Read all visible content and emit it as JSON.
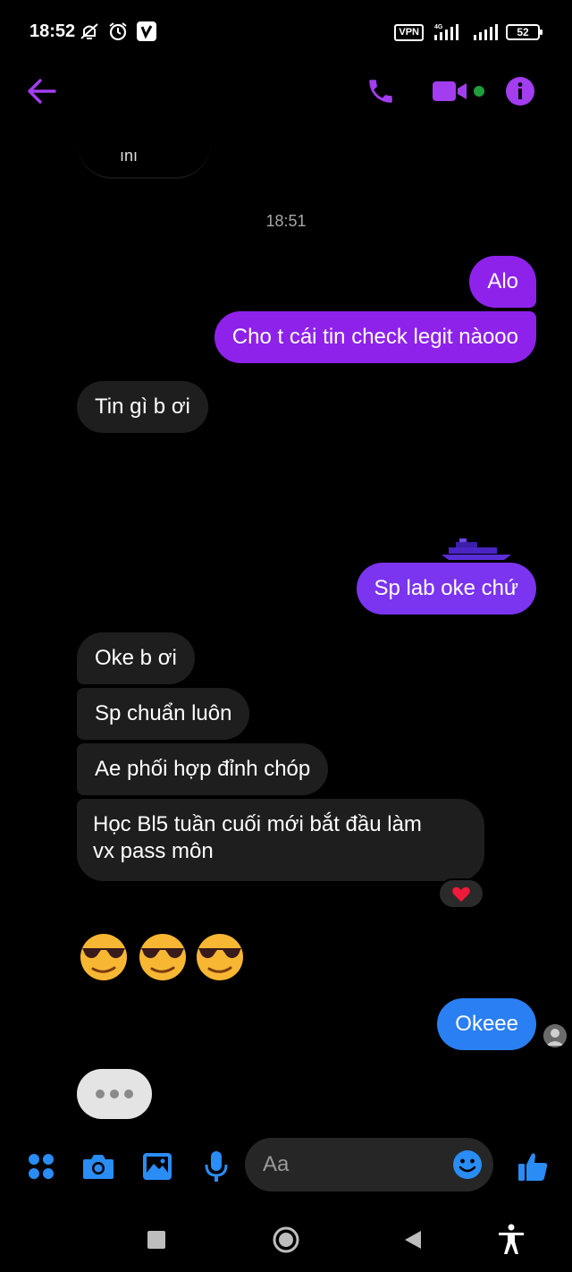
{
  "status_bar": {
    "time": "18:52",
    "vpn": "VPN",
    "network": "4G",
    "battery": "52",
    "icons": [
      "do-not-disturb-icon",
      "alarm-icon",
      "app-v-icon",
      "signal-icon",
      "signal-icon-2"
    ]
  },
  "header": {
    "contact_name": "",
    "icons": [
      "back-arrow-icon",
      "phone-icon",
      "video-icon",
      "info-icon"
    ],
    "accent_color": "#a33df0",
    "online_color": "#1f9e3b"
  },
  "chat": {
    "avatar_text": "ını",
    "timestamp": "18:51",
    "messages": [
      {
        "side": "out",
        "text": "Alo"
      },
      {
        "side": "out",
        "text": "Cho t cái tin check legit nàooo"
      },
      {
        "side": "in",
        "text": "Tin gì b ơi"
      },
      {
        "side": "out",
        "text": "Sp lab oke chứ"
      },
      {
        "side": "in",
        "text": "Oke b ơi"
      },
      {
        "side": "in",
        "text": "Sp chuẩn luôn"
      },
      {
        "side": "in",
        "text": "Ae phối hợp đỉnh chóp"
      },
      {
        "side": "in",
        "text_line1": "Học Bl5 tuần cuối mới bắt đầu làm",
        "text_line2": "vx pass môn"
      },
      {
        "side": "out",
        "text": "Okeee"
      }
    ],
    "reaction": "heart-icon",
    "emojis": [
      "sunglasses-emoji",
      "sunglasses-emoji",
      "sunglasses-emoji"
    ],
    "colors": {
      "outgoing": "#8e22ea",
      "incoming": "#1e1e1e",
      "last_outgoing": "#2a7ff2"
    }
  },
  "composer": {
    "placeholder": "Aa",
    "icons": [
      "menu-dots-icon",
      "camera-icon",
      "gallery-icon",
      "mic-icon",
      "emoji-icon",
      "like-icon"
    ],
    "accent_color": "#2a8cf5"
  },
  "nav_bar": {
    "icons": [
      "recents-icon",
      "home-icon",
      "back-icon",
      "accessibility-icon"
    ]
  }
}
